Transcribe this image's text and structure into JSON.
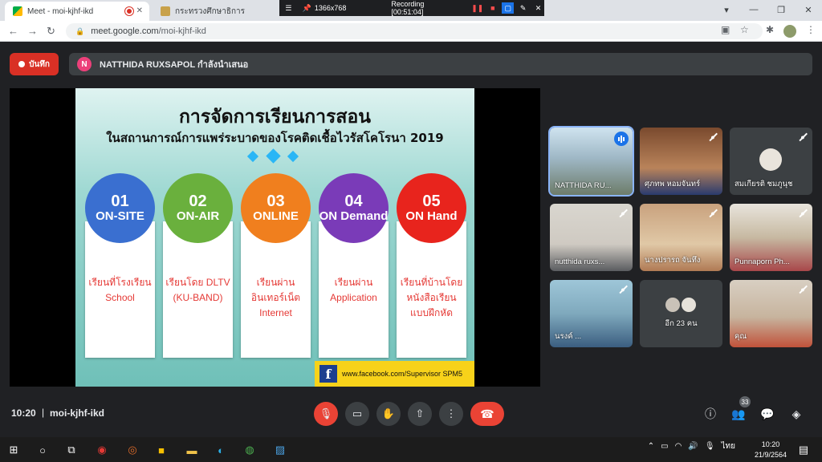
{
  "browser": {
    "tabs": [
      {
        "title": "Meet - moi-kjhf-ikd",
        "active": true
      },
      {
        "title": "กระทรวงศึกษาธิการ",
        "active": false
      }
    ],
    "url_prefix": "meet.google.com",
    "url_path": "/moi-kjhf-ikd"
  },
  "recorder": {
    "resolution": "1366x768",
    "status": "Recording [00:51:04]"
  },
  "meet": {
    "record_label": "บันทึก",
    "presenter_initial": "N",
    "presenter_text": "NATTHIDA RUXSAPOL กำลังนำเสนอ"
  },
  "slide": {
    "title_line1": "การจัดการเรียนการสอน",
    "title_line2": "ในสถานการณ์การแพร่ระบาดของโรคติดเชื้อไวรัสโคโรนา 2019",
    "options": [
      {
        "num": "01",
        "label": "ON-SITE",
        "text1": "เรียนที่โรงเรียน",
        "text2": "School",
        "text3": "",
        "color": "#3a6fd0"
      },
      {
        "num": "02",
        "label": "ON-AIR",
        "text1": "เรียนโดย DLTV",
        "text2": "(KU-BAND)",
        "text3": "",
        "color": "#6ab03d"
      },
      {
        "num": "03",
        "label": "ONLINE",
        "text1": "เรียนผ่าน",
        "text2": "อินเทอร์เน็ต",
        "text3": "Internet",
        "color": "#f07f1e"
      },
      {
        "num": "04",
        "label": "ON Demand",
        "text1": "เรียนผ่าน",
        "text2": "Application",
        "text3": "",
        "color": "#7a3bb8"
      },
      {
        "num": "05",
        "label": "ON Hand",
        "text1": "เรียนที่บ้านโดย",
        "text2": "หนังสือเรียน",
        "text3": "แบบฝึกหัด",
        "color": "#e8241d"
      }
    ],
    "facebook": "www.facebook.com/Supervisor SPM5"
  },
  "participants": [
    {
      "name": "NATTHIDA RU...",
      "speaking": true
    },
    {
      "name": "ศุภทพ หอมจันทร์",
      "speaking": false
    },
    {
      "name": "สมเกียรติ ชมภูนุช",
      "speaking": false
    },
    {
      "name": "nutthida ruxs...",
      "speaking": false
    },
    {
      "name": "นางปรารถ จันทึง",
      "speaking": false
    },
    {
      "name": "Punnaporn Ph...",
      "speaking": false
    },
    {
      "name": "นรงค์ ...",
      "speaking": false
    },
    {
      "name": "อีก 23 คน",
      "speaking": false
    },
    {
      "name": "คุณ",
      "speaking": false
    }
  ],
  "bottom": {
    "time": "10:20",
    "meeting_code": "moi-kjhf-ikd",
    "participant_count": "33"
  },
  "taskbar": {
    "time": "10:20",
    "date": "21/9/2564",
    "lang": "ไทย"
  }
}
